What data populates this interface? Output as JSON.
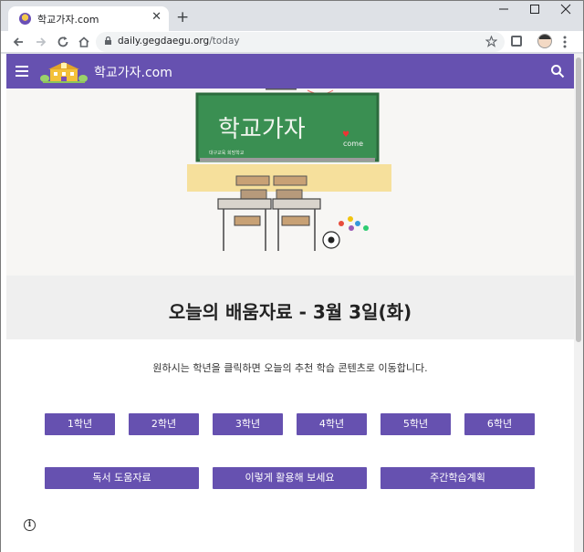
{
  "browser": {
    "tab_title": "학교가자.com",
    "url_domain": "daily.gegdaegu.org",
    "url_path": "/today",
    "close_glyph": "✕",
    "newtab_glyph": "+",
    "icons": {
      "back": "arrow-left-icon",
      "forward": "arrow-right-icon",
      "reload": "reload-icon",
      "home": "home-icon",
      "star": "star-icon",
      "menu": "kebab-menu-icon"
    }
  },
  "site": {
    "title": "학교가자.com",
    "accent": "#6651b0",
    "chalkboard_text": "학교가자",
    "chalkboard_sub": "come",
    "chalkboard_small": "대구교육 희망학교"
  },
  "main": {
    "heading": "오늘의 배움자료 - 3월 3일(화)",
    "intro": "원하시는 학년을 클릭하면 오늘의 추천 학습 콘텐츠로 이동합니다.",
    "grades": [
      "1학년",
      "2학년",
      "3학년",
      "4학년",
      "5학년",
      "6학년"
    ],
    "links": [
      "독서 도움자료",
      "이렇게 활용해 보세요",
      "주간학습계획"
    ]
  }
}
